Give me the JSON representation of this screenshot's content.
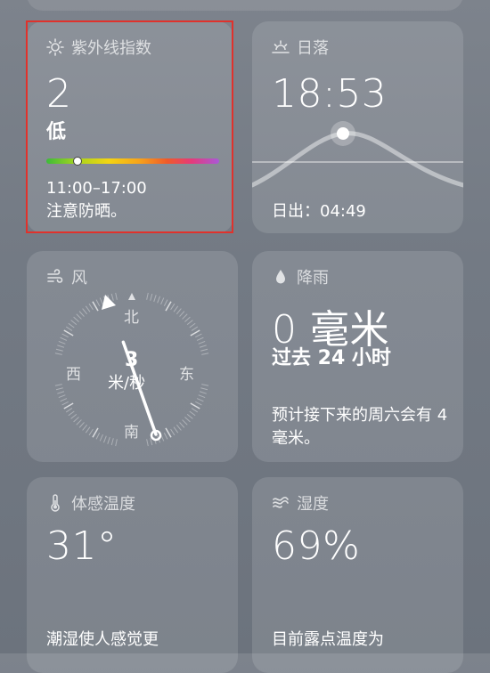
{
  "uv": {
    "title": "紫外线指数",
    "value": "2",
    "level": "低",
    "time_range": "11:00–17:00",
    "advice": "注意防晒。",
    "progress_fraction": 0.18
  },
  "sunset": {
    "title": "日落",
    "time": "18:53",
    "sunrise_label": "日出：",
    "sunrise_time": "04:49"
  },
  "wind": {
    "title": "风",
    "speed": "3",
    "unit": "米/秒",
    "dir_n": "北",
    "dir_s": "南",
    "dir_e": "东",
    "dir_w": "西"
  },
  "rain": {
    "title": "降雨",
    "amount": "0 毫米",
    "period": "过去 24 小时",
    "forecast": "预计接下来的周六会有 4 毫米。"
  },
  "feels_like": {
    "title": "体感温度",
    "value": "31°",
    "note": "潮湿使人感觉更"
  },
  "humidity": {
    "title": "湿度",
    "value": "69%",
    "note": "目前露点温度为"
  },
  "colors": {
    "highlight_border": "#e0322c"
  }
}
